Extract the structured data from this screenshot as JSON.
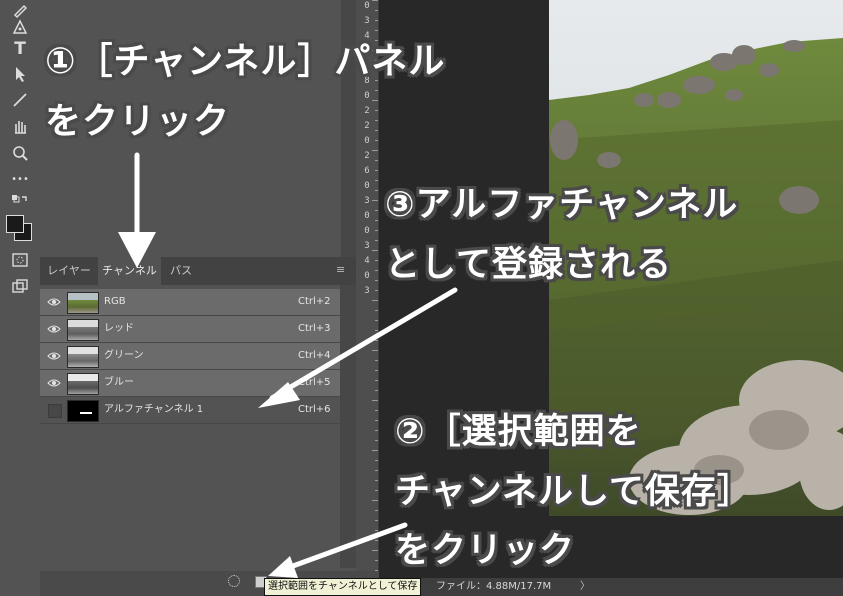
{
  "toolbar": {
    "tools": [
      "pen-icon",
      "type-icon",
      "path-select-icon",
      "line-icon",
      "hand-rotate-icon",
      "zoom-icon",
      "more-icon",
      "swap-colors-icon",
      "quick-mask-icon",
      "screen-mode-icon"
    ],
    "type_tool_glyph": "T",
    "more_glyph": "•••"
  },
  "channels_panel": {
    "tabs": [
      {
        "label": "レイヤー",
        "active": false
      },
      {
        "label": "チャンネル",
        "active": true
      },
      {
        "label": "パス",
        "active": false
      }
    ],
    "menu_glyph": "≡",
    "rows": [
      {
        "name": "RGB",
        "shortcut": "Ctrl+2",
        "visible": true,
        "selected": true
      },
      {
        "name": "レッド",
        "shortcut": "Ctrl+3",
        "visible": true,
        "selected": true
      },
      {
        "name": "グリーン",
        "shortcut": "Ctrl+4",
        "visible": true,
        "selected": true
      },
      {
        "name": "ブルー",
        "shortcut": "Ctrl+5",
        "visible": true,
        "selected": true
      },
      {
        "name": "アルファチャンネル 1",
        "shortcut": "Ctrl+6",
        "visible": false,
        "selected": false
      }
    ]
  },
  "ruler": {
    "digits": [
      "0",
      "3",
      "4",
      "0",
      "1",
      "8",
      "0",
      "2",
      "2",
      "0",
      "2",
      "6",
      "0",
      "3",
      "0",
      "0",
      "3",
      "4",
      "0",
      "3"
    ]
  },
  "status": {
    "file_info": "ファイル：4.88M/17.7M",
    "arrow": "〉",
    "tooltip": "選択範囲をチャンネルとして保存"
  },
  "callouts": {
    "step1_line1": "①［チャンネル］パネル",
    "step1_line2": "をクリック",
    "step3_line1": "③アルファチャンネル",
    "step3_line2": "として登録される",
    "step2_line1": "②［選択範囲を",
    "step2_line2": "チャンネルして保存］",
    "step2_line3": "をクリック"
  },
  "colors": {
    "panel_bg": "#535353",
    "selected_row": "#6b6b6b",
    "annotation_text": "#ffffff",
    "annotation_outline": "#4a4a4a"
  }
}
